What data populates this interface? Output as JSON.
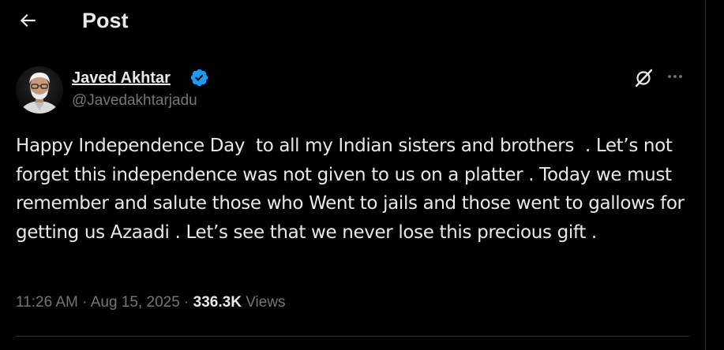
{
  "header": {
    "back_icon": "arrow-left-icon",
    "title": "Post"
  },
  "author": {
    "name": "Javed Akhtar",
    "handle": "@Javedakhtarjadu",
    "verified": true,
    "verified_color": "#1d9bf0"
  },
  "actions": {
    "grok_icon": "grok-icon",
    "more_icon": "more-horizontal-icon"
  },
  "post": {
    "text": "Happy Independence Day  to all my Indian sisters and brothers  . Let’s not forget this independence was not given to us on a platter . Today we must remember and salute those who Went to jails and those went to gallows for getting us Azaadi . Let’s see that we never lose this precious gift ."
  },
  "meta": {
    "time": "11:26 AM",
    "separator": "·",
    "date": "Aug 15, 2025",
    "views_count": "336.3K",
    "views_label": "Views"
  },
  "colors": {
    "background": "#000000",
    "text_primary": "#e7e9ea",
    "text_secondary": "#71767b",
    "border": "#2f3336"
  }
}
